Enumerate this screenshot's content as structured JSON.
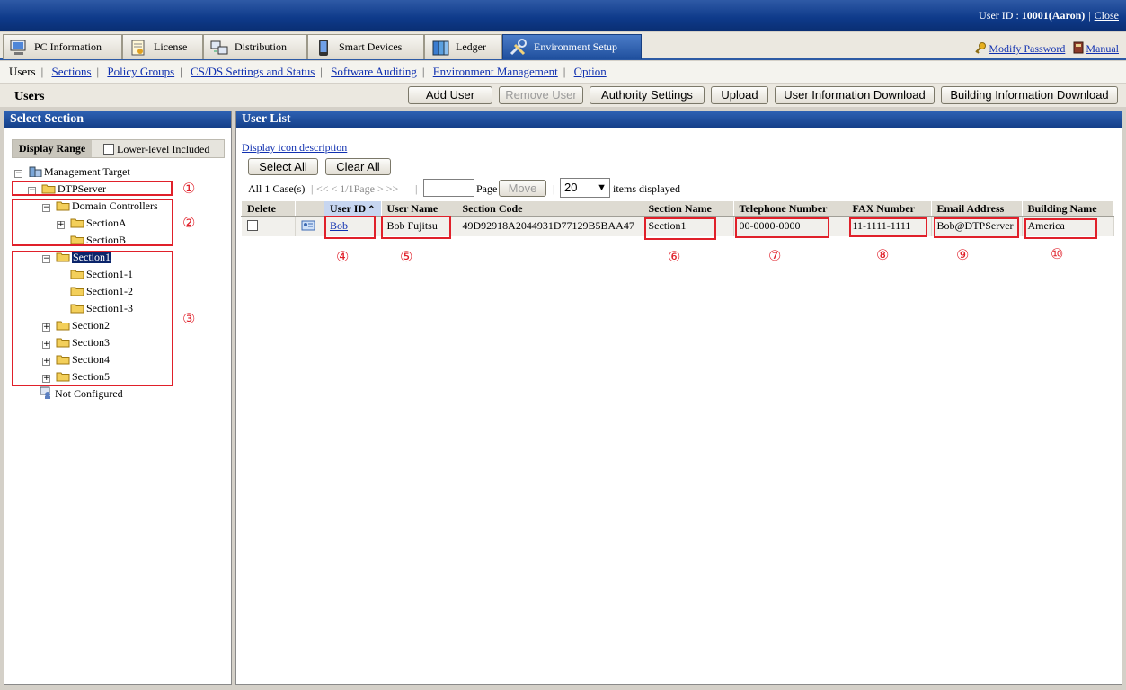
{
  "header": {
    "user_label": "User ID : ",
    "user_value": "10001(Aaron)",
    "separator": "|",
    "close_label": "Close"
  },
  "tabs": [
    {
      "label": "PC Information",
      "icon": "pc-icon"
    },
    {
      "label": "License",
      "icon": "license-icon"
    },
    {
      "label": "Distribution",
      "icon": "distribution-icon"
    },
    {
      "label": "Smart Devices",
      "icon": "smartphone-icon"
    },
    {
      "label": "Ledger",
      "icon": "ledger-icon"
    },
    {
      "label": "Environment Setup",
      "icon": "tools-icon"
    }
  ],
  "top_links": {
    "modify_password": "Modify Password",
    "manual": "Manual"
  },
  "subnav": {
    "current": "Users",
    "links": [
      "Sections",
      "Policy Groups",
      "CS/DS Settings and Status",
      "Software Auditing",
      "Environment Management",
      "Option"
    ]
  },
  "toolbar": {
    "title": "Users",
    "add_user": "Add User",
    "remove_user": "Remove User",
    "authority_settings": "Authority Settings",
    "upload": "Upload",
    "user_info_download": "User Information Download",
    "building_info_download": "Building Information Download"
  },
  "left_panel": {
    "title": "Select Section",
    "display_range": "Display Range",
    "lower_level": "Lower-level Included",
    "tree": {
      "root": "Management Target",
      "dtpserver": "DTPServer",
      "domain_controllers": "Domain Controllers",
      "sectionA": "SectionA",
      "sectionB": "SectionB",
      "section1": "Section1",
      "section1_1": "Section1-1",
      "section1_2": "Section1-2",
      "section1_3": "Section1-3",
      "section2": "Section2",
      "section3": "Section3",
      "section4": "Section4",
      "section5": "Section5",
      "not_configured": "Not Configured"
    }
  },
  "right_panel": {
    "title": "User List",
    "icon_desc": "Display icon description",
    "select_all": "Select All",
    "clear_all": "Clear All",
    "cases": "All 1 Case(s)",
    "pager": "<< < 1/1Page > >>",
    "page_label": "Page",
    "move": "Move",
    "per_page": "20",
    "items_displayed": "items displayed",
    "columns": [
      "Delete",
      "",
      "User ID",
      "User Name",
      "Section Code",
      "Section Name",
      "Telephone Number",
      "FAX Number",
      "Email Address",
      "Building Name"
    ],
    "rows": [
      {
        "user_id": "Bob",
        "user_name": "Bob Fujitsu",
        "section_code": "49D92918A2044931D77129B5BAA47",
        "section_name": "Section1",
        "telephone": "00-0000-0000",
        "fax": "11-1111-1111",
        "email": "Bob@DTPServer",
        "building": "America"
      }
    ]
  },
  "callouts": [
    "①",
    "②",
    "③",
    "④",
    "⑤",
    "⑥",
    "⑦",
    "⑧",
    "⑨",
    "⑩"
  ],
  "colors": {
    "highlight": "#e0202a",
    "header_blue": "#143f89"
  }
}
